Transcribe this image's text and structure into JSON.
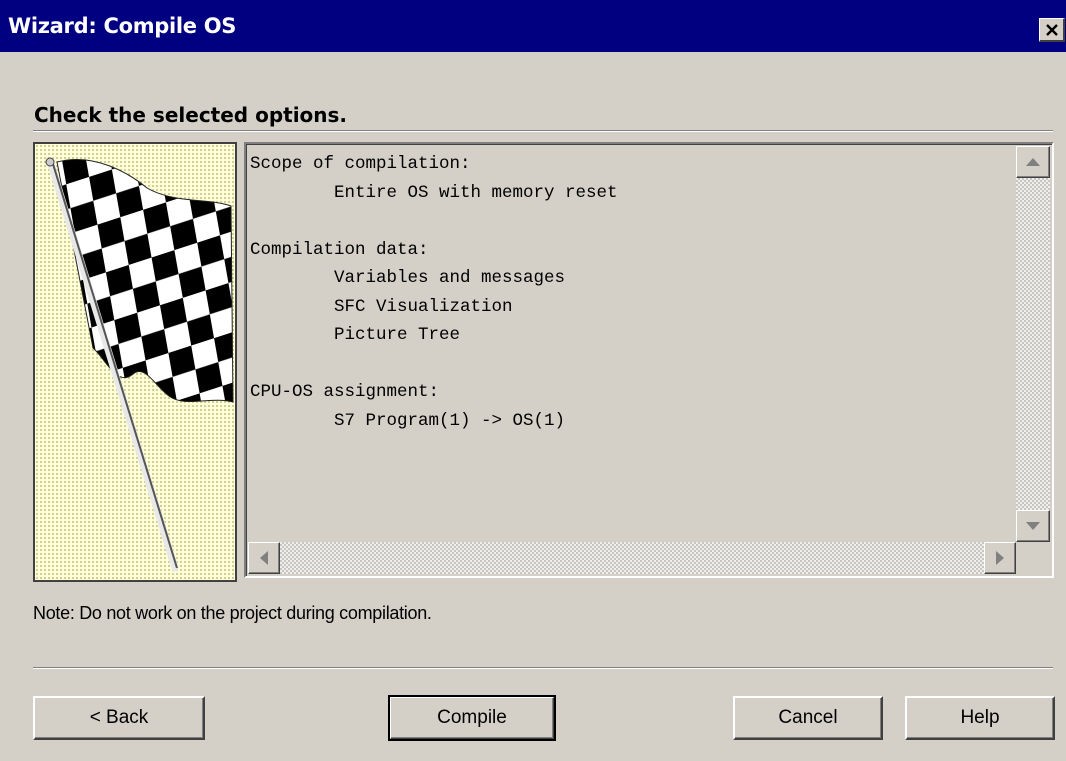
{
  "window": {
    "title": "Wizard: Compile OS",
    "close_icon": "close-icon"
  },
  "heading": "Check the selected options.",
  "summary": {
    "text": "Scope of compilation:\n        Entire OS with memory reset\n\nCompilation data:\n        Variables and messages\n        SFC Visualization\n        Picture Tree\n\nCPU-OS assignment:\n        S7 Program(1) -> OS(1)"
  },
  "image": {
    "icon": "checkered-flag-icon",
    "background_color": "#fffed8"
  },
  "note": "Note: Do not work on the project during compilation.",
  "buttons": {
    "back": "< Back",
    "compile": "Compile",
    "cancel": "Cancel",
    "help": "Help"
  },
  "colors": {
    "titlebar": "#000080",
    "face": "#d4d0c8"
  }
}
